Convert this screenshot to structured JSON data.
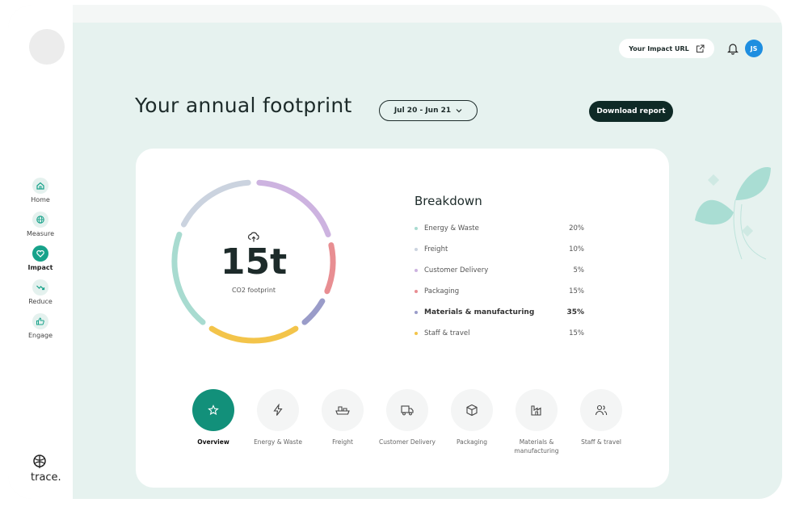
{
  "sidebar": {
    "items": [
      {
        "label": "Home",
        "icon": "home-icon",
        "active": false
      },
      {
        "label": "Measure",
        "icon": "globe-icon",
        "active": false
      },
      {
        "label": "Impact",
        "icon": "heart-icon",
        "active": true
      },
      {
        "label": "Reduce",
        "icon": "trend-down-icon",
        "active": false
      },
      {
        "label": "Engage",
        "icon": "thumbs-up-icon",
        "active": false
      }
    ],
    "brand": "trace."
  },
  "header": {
    "impact_url_label": "Your Impact URL",
    "user_initials": "JS"
  },
  "page": {
    "title": "Your annual footprint",
    "date_range": "Jul 20 - Jun 21",
    "download_label": "Download report"
  },
  "summary": {
    "total": "15t",
    "caption": "CO2 footprint"
  },
  "breakdown": {
    "title": "Breakdown",
    "items": [
      {
        "name": "Energy & Waste",
        "pct": "20%",
        "color": "#a8dbd0"
      },
      {
        "name": "Freight",
        "pct": "10%",
        "color": "#cbd3df"
      },
      {
        "name": "Customer Delivery",
        "pct": "5%",
        "color": "#cdb3e0"
      },
      {
        "name": "Packaging",
        "pct": "15%",
        "color": "#e88e92"
      },
      {
        "name": "Materials & manufacturing",
        "pct": "35%",
        "color": "#9a9cc9"
      },
      {
        "name": "Staff & travel",
        "pct": "15%",
        "color": "#f3c44a"
      }
    ]
  },
  "categories": [
    {
      "label": "Overview",
      "icon": "star-icon",
      "active": true
    },
    {
      "label": "Energy & Waste",
      "icon": "lightning-icon",
      "active": false
    },
    {
      "label": "Freight",
      "icon": "ship-icon",
      "active": false
    },
    {
      "label": "Customer Delivery",
      "icon": "truck-icon",
      "active": false
    },
    {
      "label": "Packaging",
      "icon": "box-icon",
      "active": false
    },
    {
      "label": "Materials & manufacturing",
      "icon": "factory-icon",
      "active": false
    },
    {
      "label": "Staff & travel",
      "icon": "people-icon",
      "active": false
    }
  ]
}
